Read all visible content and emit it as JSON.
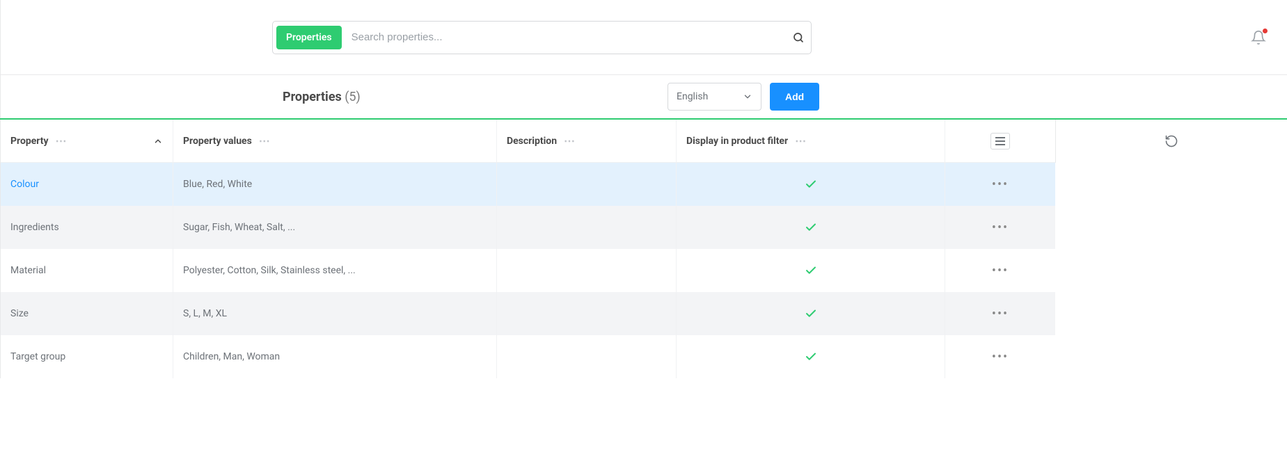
{
  "search": {
    "pill_label": "Properties",
    "placeholder": "Search properties..."
  },
  "page": {
    "title": "Properties",
    "count_display": "(5)"
  },
  "controls": {
    "language_selected": "English",
    "add_label": "Add"
  },
  "columns": {
    "property": "Property",
    "values": "Property values",
    "description": "Description",
    "filter": "Display in product filter"
  },
  "rows": [
    {
      "property": "Colour",
      "values": "Blue, Red, White",
      "description": "",
      "in_filter": true,
      "selected": true
    },
    {
      "property": "Ingredients",
      "values": "Sugar, Fish, Wheat, Salt, ...",
      "description": "",
      "in_filter": true,
      "selected": false
    },
    {
      "property": "Material",
      "values": "Polyester, Cotton, Silk, Stainless steel, ...",
      "description": "",
      "in_filter": true,
      "selected": false
    },
    {
      "property": "Size",
      "values": "S, L, M, XL",
      "description": "",
      "in_filter": true,
      "selected": false
    },
    {
      "property": "Target group",
      "values": "Children, Man, Woman",
      "description": "",
      "in_filter": true,
      "selected": false
    }
  ]
}
